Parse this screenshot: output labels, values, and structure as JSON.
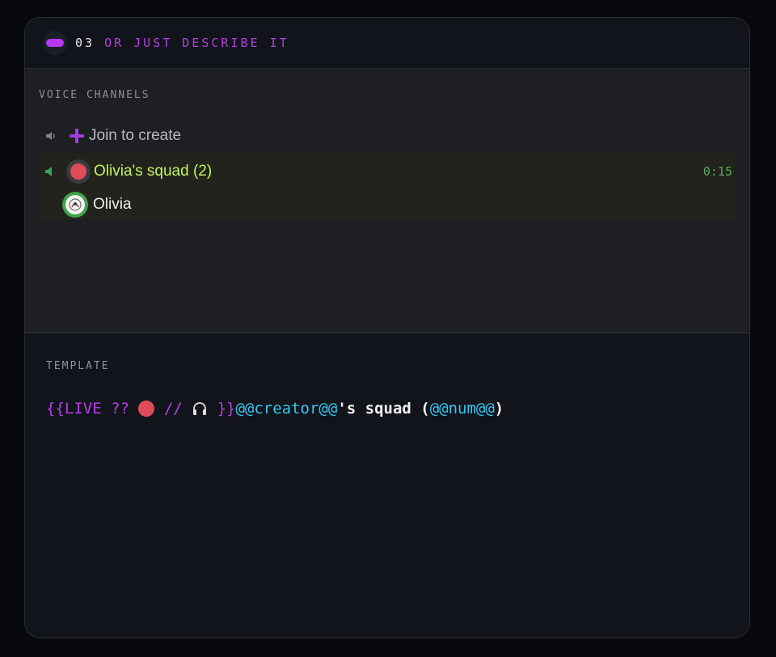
{
  "header": {
    "step_number": "03",
    "step_title": "OR JUST DESCRIBE IT",
    "accent_color": "#b537f2"
  },
  "voice_panel": {
    "section_label": "VOICE CHANNELS",
    "create_channel": {
      "label": "Join to create",
      "icons": [
        "speaker-icon",
        "plus-icon"
      ]
    },
    "active_channel": {
      "label": "Olivia's squad (2)",
      "timer": "0:15",
      "label_color": "#c3f55a",
      "icons": [
        "speaker-active-icon",
        "live-dot-icon"
      ]
    },
    "members": [
      {
        "name": "Olivia",
        "avatar": "avatar-icon"
      }
    ]
  },
  "template": {
    "section_label": "TEMPLATE",
    "parts": {
      "open": "{{LIVE ?? ",
      "sep": " // ",
      "close": " }}",
      "creator_var": "@@creator@@",
      "middle": "'s squad (",
      "num_var": "@@num@@",
      "end": ")"
    }
  }
}
